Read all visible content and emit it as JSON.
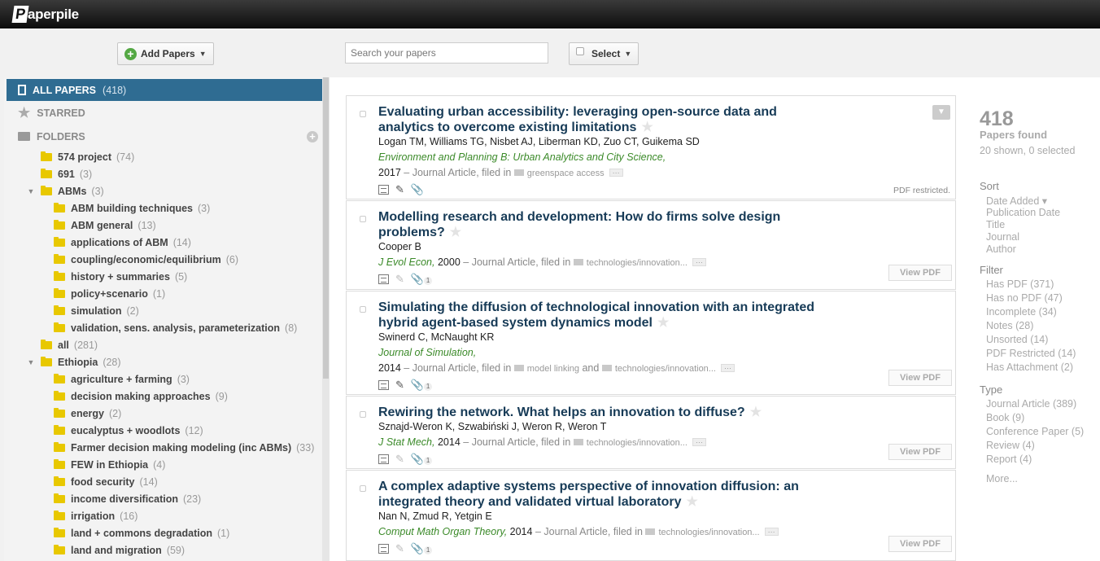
{
  "app": {
    "logo_letter": "P",
    "logo_text": "aperpile"
  },
  "toolbar": {
    "add_papers": "Add Papers",
    "search_placeholder": "Search your papers",
    "select": "Select"
  },
  "sidebar": {
    "all_papers": {
      "label": "ALL PAPERS",
      "count": "(418)"
    },
    "starred": "STARRED",
    "folders_label": "FOLDERS",
    "folders": [
      {
        "name": "574 project",
        "count": "(74)",
        "level": 0,
        "expanded": null
      },
      {
        "name": "691",
        "count": "(3)",
        "level": 0,
        "expanded": null
      },
      {
        "name": "ABMs",
        "count": "(3)",
        "level": 0,
        "expanded": true
      },
      {
        "name": "ABM building techniques",
        "count": "(3)",
        "level": 1,
        "expanded": null
      },
      {
        "name": "ABM general",
        "count": "(13)",
        "level": 1,
        "expanded": null
      },
      {
        "name": "applications of ABM",
        "count": "(14)",
        "level": 1,
        "expanded": null
      },
      {
        "name": "coupling/economic/equilibrium",
        "count": "(6)",
        "level": 1,
        "expanded": null
      },
      {
        "name": "history + summaries",
        "count": "(5)",
        "level": 1,
        "expanded": null
      },
      {
        "name": "policy+scenario",
        "count": "(1)",
        "level": 1,
        "expanded": null
      },
      {
        "name": "simulation",
        "count": "(2)",
        "level": 1,
        "expanded": null
      },
      {
        "name": "validation, sens. analysis, parameterization",
        "count": "(8)",
        "level": 1,
        "expanded": null
      },
      {
        "name": "all",
        "count": "(281)",
        "level": 0,
        "expanded": null
      },
      {
        "name": "Ethiopia",
        "count": "(28)",
        "level": 0,
        "expanded": true
      },
      {
        "name": "agriculture + farming",
        "count": "(3)",
        "level": 1,
        "expanded": null
      },
      {
        "name": "decision making approaches",
        "count": "(9)",
        "level": 1,
        "expanded": null
      },
      {
        "name": "energy",
        "count": "(2)",
        "level": 1,
        "expanded": null
      },
      {
        "name": "eucalyptus + woodlots",
        "count": "(12)",
        "level": 1,
        "expanded": null
      },
      {
        "name": "Farmer decision making modeling (inc ABMs)",
        "count": "(33)",
        "level": 1,
        "expanded": null
      },
      {
        "name": "FEW in Ethiopia",
        "count": "(4)",
        "level": 1,
        "expanded": null
      },
      {
        "name": "food security",
        "count": "(14)",
        "level": 1,
        "expanded": null
      },
      {
        "name": "income diversification",
        "count": "(23)",
        "level": 1,
        "expanded": null
      },
      {
        "name": "irrigation",
        "count": "(16)",
        "level": 1,
        "expanded": null
      },
      {
        "name": "land + commons degradation",
        "count": "(1)",
        "level": 1,
        "expanded": null
      },
      {
        "name": "land and migration",
        "count": "(59)",
        "level": 1,
        "expanded": null
      }
    ]
  },
  "papers": [
    {
      "title": "Evaluating urban accessibility: leveraging open-source data and analytics to overcome existing limitations",
      "authors": "Logan TM, Williams TG, Nisbet AJ, Liberman KD, Zuo CT, Guikema SD",
      "journal": "Environment and Planning B: Urban Analytics and City Science,",
      "year": "2017",
      "type": "– Journal Article, filed in",
      "folders": [
        "greenspace access"
      ],
      "folders_joiner": "",
      "action": "PDF restricted.",
      "attachments": ""
    },
    {
      "title": "Modelling research and development: How do firms solve design problems?",
      "authors": "Cooper B",
      "journal": "J Evol Econ,",
      "year": "2000",
      "type": "– Journal Article, filed in",
      "folders": [
        "technologies/innovation..."
      ],
      "folders_joiner": "",
      "action": "View PDF",
      "attachments": "1"
    },
    {
      "title": "Simulating the diffusion of technological innovation with an integrated hybrid agent-based system dynamics model",
      "authors": "Swinerd C, McNaught KR",
      "journal": "Journal of Simulation,",
      "year": "2014",
      "type": "– Journal Article, filed in",
      "folders": [
        "model linking",
        "technologies/innovation..."
      ],
      "folders_joiner": "and",
      "action": "View PDF",
      "attachments": "1"
    },
    {
      "title": "Rewiring the network. What helps an innovation to diffuse?",
      "authors": "Sznajd-Weron K, Szwabiński J, Weron R, Weron T",
      "journal": "J Stat Mech,",
      "year": "2014",
      "type": "– Journal Article, filed in",
      "folders": [
        "technologies/innovation..."
      ],
      "folders_joiner": "",
      "action": "View PDF",
      "attachments": "1"
    },
    {
      "title": "A complex adaptive systems perspective of innovation diffusion: an integrated theory and validated virtual laboratory",
      "authors": "Nan N, Zmud R, Yetgin E",
      "journal": "Comput Math Organ Theory,",
      "year": "2014",
      "type": "– Journal Article, filed in",
      "folders": [
        "technologies/innovation..."
      ],
      "folders_joiner": "",
      "action": "View PDF",
      "attachments": "1"
    }
  ],
  "summary": {
    "count": "418",
    "found": "Papers found",
    "shown": "20 shown, 0 selected"
  },
  "sort": {
    "label": "Sort",
    "options": [
      "Date Added ▾",
      "Publication Date",
      "Title",
      "Journal",
      "Author"
    ]
  },
  "filter": {
    "label": "Filter",
    "options": [
      "Has PDF (371)",
      "Has no PDF (47)",
      "Incomplete (34)",
      "Notes (28)",
      "Unsorted (14)",
      "PDF Restricted (14)",
      "Has Attachment (2)"
    ]
  },
  "type": {
    "label": "Type",
    "options": [
      "Journal Article (389)",
      "Book (9)",
      "Conference Paper (5)",
      "Review (4)",
      "Report (4)",
      "More..."
    ]
  }
}
